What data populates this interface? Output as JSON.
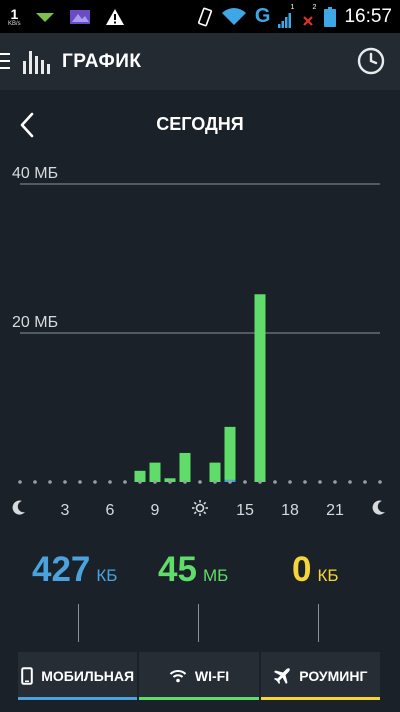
{
  "statusbar": {
    "speed_value": "1",
    "speed_unit": "KB/s",
    "sim1": "1",
    "sim2": "2",
    "network": "G",
    "time": "16:57"
  },
  "appbar": {
    "title": "ГРАФИК",
    "logo_icon": "bar-chart-icon",
    "clock_icon": "clock-icon"
  },
  "header": {
    "back_icon": "chevron-left-icon",
    "date_label": "СЕГОДНЯ"
  },
  "chart_data": {
    "type": "bar",
    "ylim": [
      0,
      40
    ],
    "gridlines": [
      {
        "value": 40,
        "label": "40 МБ"
      },
      {
        "value": 20,
        "label": "20 МБ"
      }
    ],
    "x_ticks": [
      {
        "hour": 0,
        "label": "moon-icon"
      },
      {
        "hour": 3,
        "label": "3"
      },
      {
        "hour": 6,
        "label": "6"
      },
      {
        "hour": 9,
        "label": "9"
      },
      {
        "hour": 12,
        "label": "sun-icon"
      },
      {
        "hour": 15,
        "label": "15"
      },
      {
        "hour": 18,
        "label": "18"
      },
      {
        "hour": 21,
        "label": "21"
      },
      {
        "hour": 24,
        "label": "moon-icon"
      }
    ],
    "series": [
      {
        "color": "#5fdc6a",
        "points": [
          {
            "hour": 8,
            "value": 1.5
          },
          {
            "hour": 9,
            "value": 2.6
          },
          {
            "hour": 10,
            "value": 0.5
          },
          {
            "hour": 11,
            "value": 3.9
          },
          {
            "hour": 13,
            "value": 2.6
          },
          {
            "hour": 14,
            "value": 7.4
          },
          {
            "hour": 16,
            "value": 25.2
          }
        ]
      },
      {
        "color": "#4aa3df",
        "points": [
          {
            "hour": 14,
            "value": 0.3
          }
        ]
      }
    ]
  },
  "totals": {
    "mobile": {
      "value": "427",
      "unit": "КБ",
      "color": "#4aa3df"
    },
    "wifi": {
      "value": "45",
      "unit": "МБ",
      "color": "#5fdc6a"
    },
    "roaming": {
      "value": "0",
      "unit": "КБ",
      "color": "#f4d53a"
    }
  },
  "tabs": [
    {
      "label": "МОБИЛЬНАЯ",
      "icon": "phone-icon",
      "color": "#4aa3df"
    },
    {
      "label": "WI-FI",
      "icon": "wifi-icon",
      "color": "#5fdc6a"
    },
    {
      "label": "РОУМИНГ",
      "icon": "airplane-icon",
      "color": "#f4d53a"
    }
  ]
}
